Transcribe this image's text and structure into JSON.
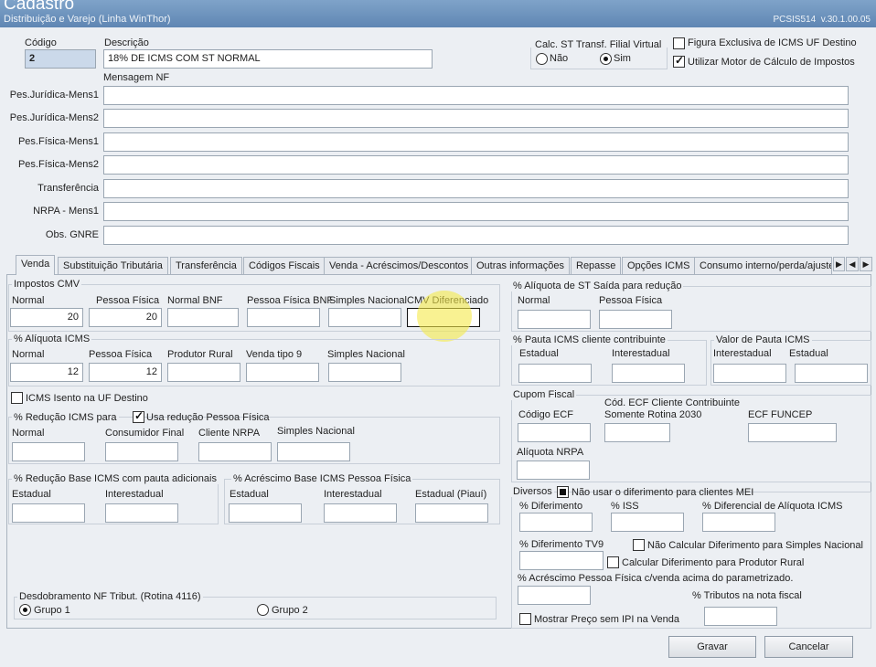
{
  "window": {
    "title": "Cadastro",
    "subtitle": "Distribuição e Varejo (Linha WinThor)",
    "routine": "PCSIS514  v.30.1.00.05"
  },
  "header": {
    "codigo_label": "Código",
    "codigo_value": "2",
    "descricao_label": "Descrição",
    "descricao_value": "18% DE ICMS COM ST NORMAL",
    "calc_st_label": "Calc. ST Transf. Filial Virtual",
    "radio_nao": "Não",
    "radio_sim": "Sim",
    "figura_exclusiva": "Figura Exclusiva de ICMS UF Destino",
    "utilizar_motor": "Utilizar Motor de Cálculo de Impostos",
    "mensagem_nf_label": "Mensagem NF",
    "msgs": [
      {
        "label": "Pes.Jurídica-Mens1",
        "value": ""
      },
      {
        "label": "Pes.Jurídica-Mens2",
        "value": ""
      },
      {
        "label": "Pes.Física-Mens1",
        "value": ""
      },
      {
        "label": "Pes.Física-Mens2",
        "value": ""
      },
      {
        "label": "Transferência",
        "value": ""
      },
      {
        "label": "NRPA - Mens1",
        "value": ""
      },
      {
        "label": "Obs. GNRE",
        "value": ""
      }
    ]
  },
  "tabs": [
    "Venda",
    "Substituição Tributária",
    "Transferência",
    "Códigos Fiscais",
    "Venda - Acréscimos/Descontos",
    "Outras informações",
    "Repasse",
    "Opções ICMS",
    "Consumo interno/perda/ajuste"
  ],
  "impostos_cmv": {
    "title": "Impostos CMV",
    "normal_label": "Normal",
    "normal_value": "20",
    "pf_label": "Pessoa Física",
    "pf_value": "20",
    "normal_bnf": "Normal BNF",
    "pf_bnf": "Pessoa Física BNF",
    "simples": "Simples Nacional",
    "cmv_dif": "CMV Diferenciado"
  },
  "aliquota_icms": {
    "title": "% Alíquota ICMS",
    "normal_label": "Normal",
    "normal_value": "12",
    "pf_label": "Pessoa Física",
    "pf_value": "12",
    "produtor_rural": "Produtor Rural",
    "venda_tipo9": "Venda tipo 9",
    "simples": "Simples Nacional"
  },
  "icms_isento": "ICMS Isento na UF Destino",
  "reducao_icms": {
    "title": "% Redução ICMS para",
    "usa_reducao": "Usa redução Pessoa Física",
    "normal": "Normal",
    "consumidor_final": "Consumidor Final",
    "cliente_nrpa": "Cliente NRPA",
    "simples": "Simples Nacional"
  },
  "reducao_base": {
    "title": "% Redução Base ICMS com pauta adicionais",
    "estadual": "Estadual",
    "interestadual": "Interestadual"
  },
  "acrescimo_base": {
    "title": "% Acréscimo Base ICMS Pessoa Física",
    "estadual": "Estadual",
    "interestadual": "Interestadual",
    "estadual_piaui": "Estadual (Piauí)"
  },
  "desdobramento": {
    "title": "Desdobramento NF Tribut. (Rotina 4116)",
    "grupo1": "Grupo 1",
    "grupo2": "Grupo 2"
  },
  "aliquota_st": {
    "title": "% Alíquota de ST Saída para redução",
    "normal": "Normal",
    "pf": "Pessoa Física"
  },
  "pauta_icms": {
    "title": "% Pauta ICMS cliente contribuinte",
    "estadual": "Estadual",
    "interestadual": "Interestadual"
  },
  "valor_pauta": {
    "title": "Valor de Pauta ICMS",
    "interestadual": "Interestadual",
    "estadual": "Estadual"
  },
  "cupom_fiscal": {
    "title": "Cupom Fiscal",
    "codigo_ecf": "Código ECF",
    "cod_ecf_cliente": "Cód. ECF Cliente Contribuinte",
    "somente_rotina": "Somente Rotina 2030",
    "ecf_funcep": "ECF FUNCEP",
    "aliquota_nrpa": "Alíquota NRPA"
  },
  "diversos": {
    "title": "Diversos",
    "nao_usar_diferimento": "Não usar o diferimento para clientes MEI",
    "pct_diferimento": "% Diferimento",
    "pct_iss": "% ISS",
    "pct_dif_aliquota": "% Diferencial de Alíquota ICMS",
    "pct_diferimento_tv9": "% Diferimento TV9",
    "nao_calcular_simples": "Não Calcular Diferimento para Simples Nacional",
    "calcular_produtor": "Calcular Diferimento para Produtor Rural",
    "acrescimo_pf": "% Acréscimo Pessoa Física c/venda acima do parametrizado.",
    "tributos_nota": "% Tributos na nota fiscal",
    "mostrar_preco": "Mostrar Preço sem IPI na Venda"
  },
  "buttons": {
    "gravar": "Gravar",
    "cancelar": "Cancelar"
  },
  "colors": {
    "title_bar": "#5f86b3",
    "panel": "#eceff3",
    "highlight": "#f5e94a"
  }
}
